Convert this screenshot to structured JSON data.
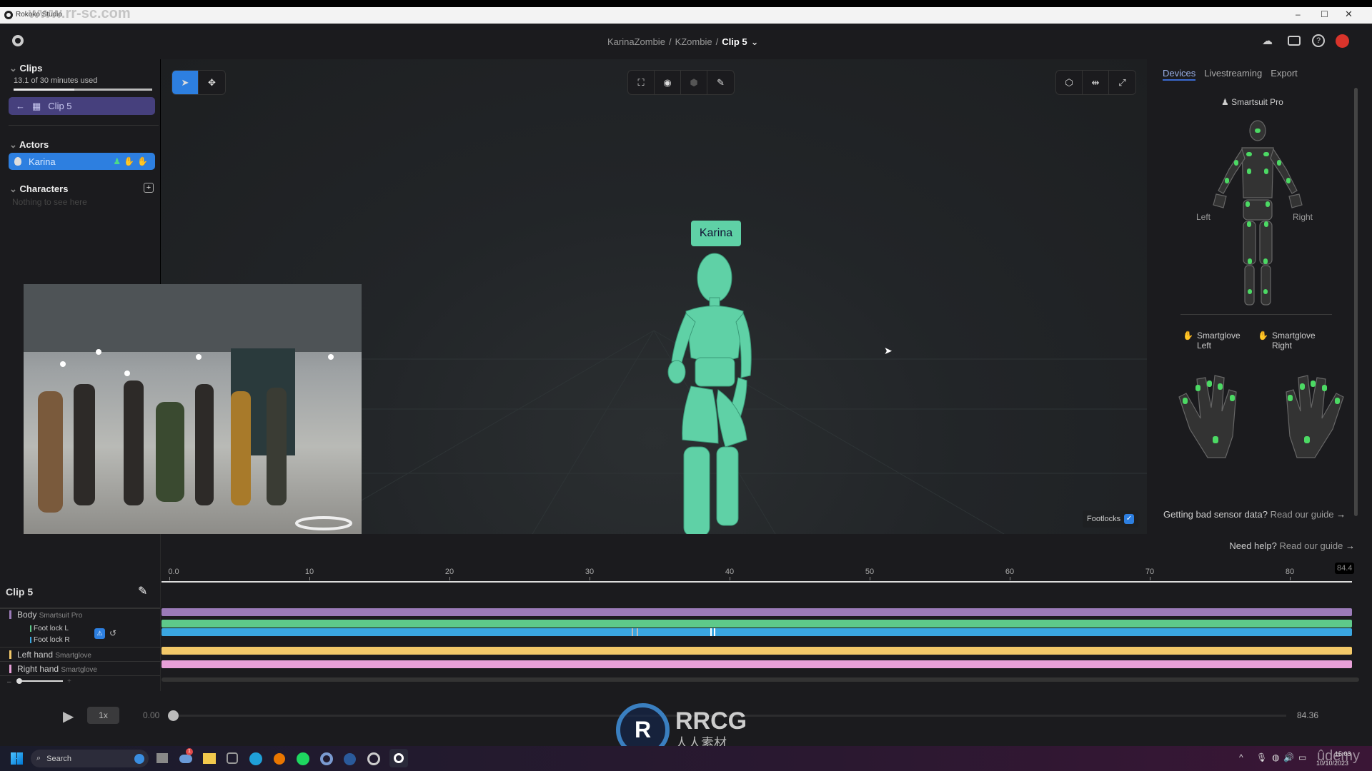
{
  "window": {
    "title": "Rokoko Studio",
    "watermark": "www.rr-sc.com"
  },
  "header": {
    "breadcrumb_project": "KarinaZombie",
    "breadcrumb_sep": "/",
    "breadcrumb_scene": "KZombie",
    "breadcrumb_clip": "Clip 5"
  },
  "sidebar": {
    "clips": {
      "title": "Clips",
      "usage": "13.1 of 30 minutes used",
      "usage_fraction": 0.437,
      "active_clip": "Clip 5"
    },
    "actors": {
      "title": "Actors",
      "items": [
        {
          "name": "Karina"
        }
      ]
    },
    "characters": {
      "title": "Characters",
      "empty": "Nothing to see here"
    }
  },
  "viewport": {
    "actor_label": "Karina",
    "footlocks_label": "Footlocks",
    "footlocks_checked": true,
    "actor_color": "#5fd1a6"
  },
  "rpanel": {
    "tabs": [
      "Devices",
      "Livestreaming",
      "Export"
    ],
    "active_tab": "Devices",
    "suit": "Smartsuit Pro",
    "left": "Left",
    "right": "Right",
    "glove_left": [
      "Smartglove",
      "Left"
    ],
    "glove_right": [
      "Smartglove",
      "Right"
    ],
    "bad_data_q": "Getting bad sensor data?",
    "guide_link": "Read our guide",
    "help_q": "Need help?",
    "help_link": "Read our guide",
    "arrow": "→",
    "sensor_color": "#4cd964"
  },
  "timeline": {
    "clip_title": "Clip 5",
    "ticks": [
      "0.0",
      "10",
      "20",
      "30",
      "40",
      "50",
      "60",
      "70",
      "80"
    ],
    "end_label": "84.4",
    "tracks": [
      {
        "name": "Body",
        "device": "Smartsuit Pro",
        "color": "#9b7bb8"
      },
      {
        "name": "Foot lock L",
        "color": "#5ec98a"
      },
      {
        "name": "Foot lock R",
        "color": "#3aa6e0"
      },
      {
        "name": "Left hand",
        "device": "Smartglove",
        "color": "#f3c969"
      },
      {
        "name": "Right hand",
        "device": "Smartglove",
        "color": "#e8a0d8"
      }
    ]
  },
  "playback": {
    "speed": "1x",
    "current": "0.00",
    "total": "84.36",
    "progress": 0
  },
  "taskbar": {
    "search": "Search",
    "time": "15:03",
    "date": "10/10/2023",
    "notif_count": "1"
  },
  "overlay": {
    "logo_text": "RRCG",
    "logo_sub": "人人素材",
    "udemy": "ûdemy"
  }
}
